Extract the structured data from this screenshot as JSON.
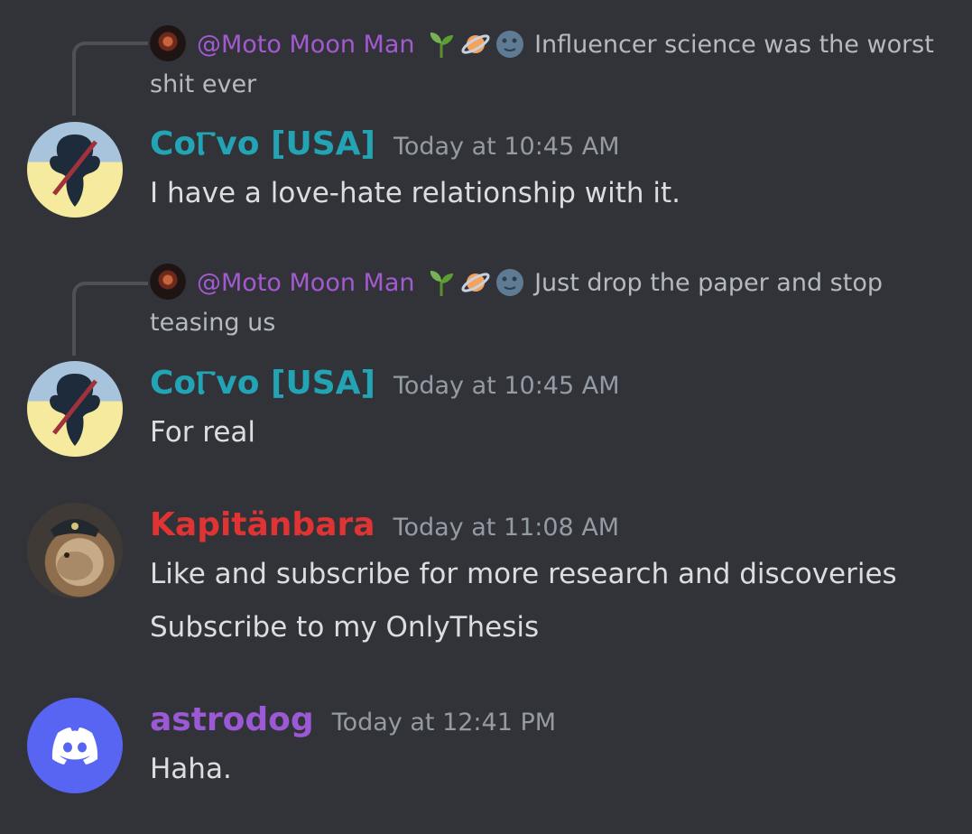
{
  "reply1": {
    "mention": "@Moto Moon Man",
    "text": "Influencer science was the worst shit ever"
  },
  "reply2": {
    "mention": "@Moto Moon Man",
    "text": "Just drop the paper and stop teasing us"
  },
  "messages": [
    {
      "author": "CoⲄvo [USA]",
      "time": "Today at 10:45 AM",
      "lines": [
        "I have a love-hate relationship with it."
      ]
    },
    {
      "author": "CoⲄvo [USA]",
      "time": "Today at 10:45 AM",
      "lines": [
        "For real"
      ]
    },
    {
      "author": "Kapitänbara",
      "time": "Today at 11:08 AM",
      "lines": [
        "Like and subscribe for more research and discoveries",
        "Subscribe to my OnlyThesis"
      ]
    },
    {
      "author": "astrodog",
      "time": "Today at 12:41 PM",
      "lines": [
        "Haha."
      ]
    }
  ],
  "icons": [
    "seedling-emoji",
    "ringed-planet-emoji",
    "new-moon-face-emoji",
    "discord-logo-icon"
  ],
  "colors": {
    "background": "#313338",
    "mention": "#a35ad1",
    "corvo": "#23a4b4",
    "kapitanbara": "#e03434",
    "astrodog": "#9b59d6",
    "timestamp": "#949ba4",
    "text": "#dbdee1"
  }
}
